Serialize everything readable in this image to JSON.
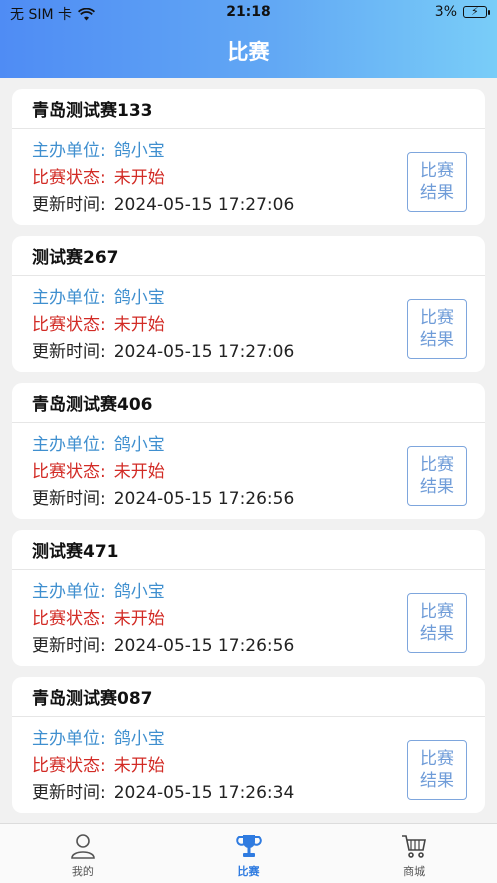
{
  "status_bar": {
    "carrier": "无 SIM 卡",
    "time": "21:18",
    "battery": "3%"
  },
  "nav": {
    "title": "比赛"
  },
  "labels": {
    "org": "主办单位:",
    "state": "比赛状态:",
    "time": "更新时间:",
    "result_line1": "比赛",
    "result_line2": "结果"
  },
  "matches": [
    {
      "name": "青岛测试赛133",
      "org": "鸽小宝",
      "state": "未开始",
      "updated": "2024-05-15 17:27:06"
    },
    {
      "name": "测试赛267",
      "org": "鸽小宝",
      "state": "未开始",
      "updated": "2024-05-15 17:27:06"
    },
    {
      "name": "青岛测试赛406",
      "org": "鸽小宝",
      "state": "未开始",
      "updated": "2024-05-15 17:26:56"
    },
    {
      "name": "测试赛471",
      "org": "鸽小宝",
      "state": "未开始",
      "updated": "2024-05-15 17:26:56"
    },
    {
      "name": "青岛测试赛087",
      "org": "鸽小宝",
      "state": "未开始",
      "updated": "2024-05-15 17:26:34"
    }
  ],
  "tabbar": {
    "items": [
      {
        "label": "我的",
        "icon": "user-icon"
      },
      {
        "label": "比赛",
        "icon": "trophy-icon",
        "active": true
      },
      {
        "label": "商城",
        "icon": "cart-icon"
      }
    ],
    "active_color": "#2f7be0"
  }
}
